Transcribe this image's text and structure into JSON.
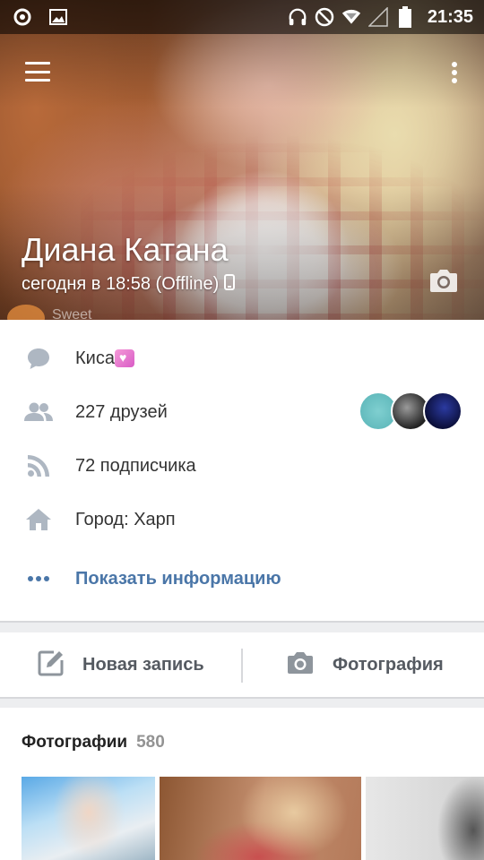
{
  "status_bar": {
    "time": "21:35",
    "icons": [
      "vk-circle-icon",
      "image-icon",
      "headset-icon",
      "do-not-disturb-icon",
      "wifi-icon",
      "signal-icon",
      "battery-icon"
    ]
  },
  "profile": {
    "name": "Диана Катана",
    "online_status": "сегодня в 18:58 (Offline)",
    "cover_sticker_text": "Sweet"
  },
  "info": {
    "status_text": "Киса",
    "friends": "227 друзей",
    "followers": "72 подписчика",
    "city": "Город: Харп",
    "show_info": "Показать информацию"
  },
  "actions": {
    "new_post": "Новая запись",
    "photo": "Фотография"
  },
  "photos": {
    "title": "Фотографии",
    "count": "580"
  },
  "colors": {
    "link_blue": "#4a76a8",
    "icon_gray": "#aeb7c2",
    "background": "#edeef0"
  }
}
